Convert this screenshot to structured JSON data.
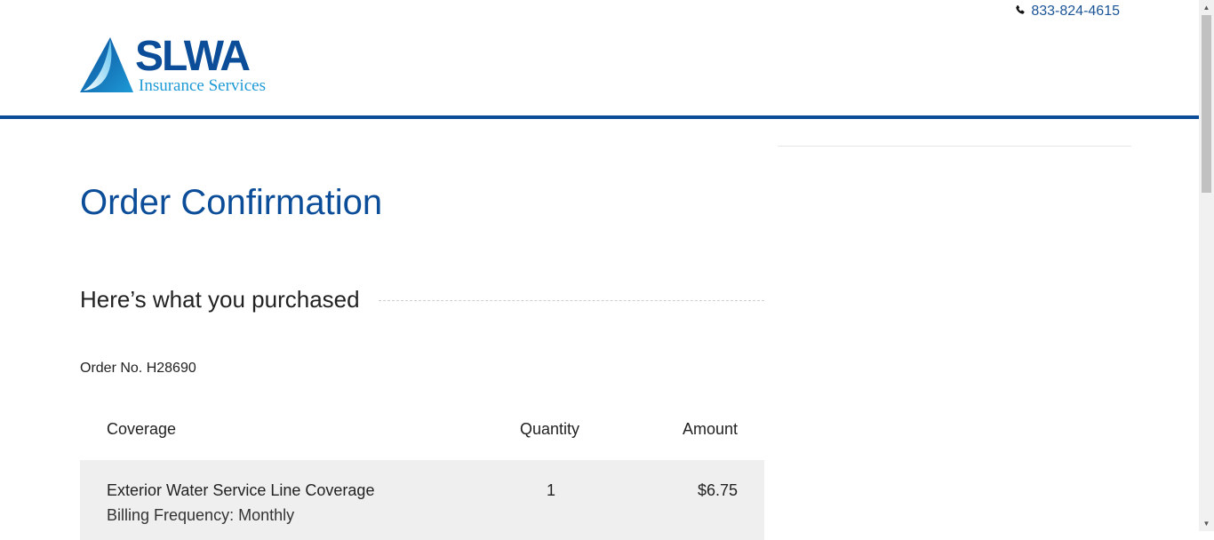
{
  "header": {
    "phone": "833-824-4615",
    "logo": {
      "word": "SLWA",
      "subtitle": "Insurance Services"
    }
  },
  "main": {
    "title": "Order Confirmation",
    "section_title": "Here’s what you purchased",
    "order_number": "Order No. H28690",
    "table": {
      "columns": [
        "Coverage",
        "Quantity",
        "Amount"
      ],
      "rows": [
        {
          "coverage": "Exterior Water Service Line Coverage",
          "billing": "Billing Frequency: Monthly",
          "quantity": "1",
          "amount": "$6.75"
        }
      ]
    }
  },
  "colors": {
    "brand": "#0b4d98",
    "accent": "#1e9ad6",
    "row_bg": "#efefef"
  },
  "icons": {
    "phone": "phone-icon",
    "logo_mark": "sail-logo-icon"
  }
}
